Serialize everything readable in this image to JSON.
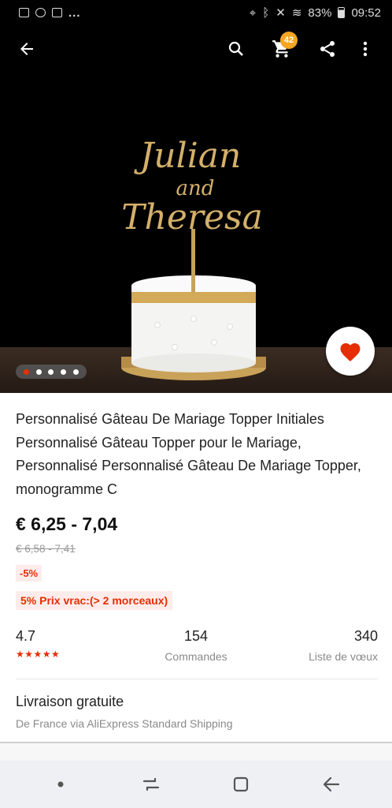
{
  "status_bar": {
    "dots": "...",
    "battery": "83%",
    "time": "09:52"
  },
  "header": {
    "cart_count": "42"
  },
  "product": {
    "title": "Personnalisé Gâteau De Mariage Topper Initiales Personnalisé Gâteau Topper pour le Mariage, Personnalisé Personnalisé Gâteau De Mariage Topper, monogramme C",
    "price": "€ 6,25 - 7,04",
    "old_price": "€ 6,58 - 7,41",
    "discount": "-5%",
    "bulk_price": "5% Prix vrac:(> 2 morceaux)",
    "image_topper_text": [
      "Julian",
      "and",
      "Theresa"
    ],
    "carousel": {
      "count": 5,
      "active": 1
    }
  },
  "stats": {
    "rating": "4.7",
    "stars": "★★★★★",
    "orders": "154",
    "orders_label": "Commandes",
    "wishlist": "340",
    "wishlist_label": "Liste de vœux"
  },
  "shipping": {
    "title": "Livraison gratuite",
    "subtitle": "De France via AliExpress Standard Shipping"
  },
  "colors": {
    "accent": "#e62e04",
    "badge": "#f5a623",
    "gold": "#c9a25a"
  }
}
